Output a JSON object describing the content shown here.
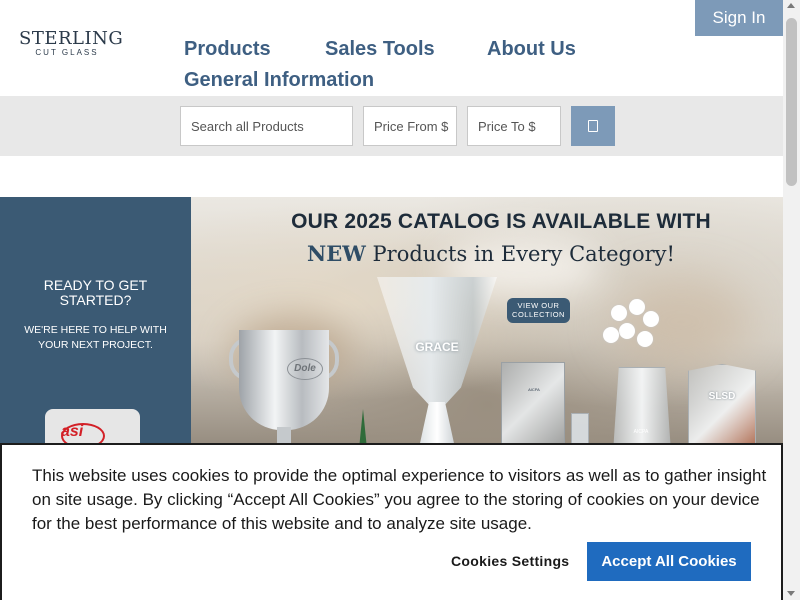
{
  "header": {
    "logo_main": "STERLING",
    "logo_sub": "CUT GLASS",
    "sign_in": "Sign In"
  },
  "nav": {
    "items": [
      "Products",
      "Sales Tools",
      "About Us",
      "General Information"
    ]
  },
  "search": {
    "search_placeholder": "Search all Products",
    "price_from_placeholder": "Price From $",
    "price_to_placeholder": "Price To $",
    "button_icon": "search-icon"
  },
  "hero": {
    "left": {
      "ready": "READY TO GET STARTED?",
      "help": "WE'RE HERE TO HELP WITH YOUR NEXT PROJECT.",
      "badge": "asi"
    },
    "headline_1": "OUR 2025 CATALOG IS AVAILABLE WITH",
    "headline_2_bold": "NEW",
    "headline_2_rest": " Products in Every Category!",
    "view_button": "VIEW OUR COLLECTION",
    "trophy_labels": {
      "cup": "Dole",
      "vase": "GRACE",
      "flower_vase": "AICPA",
      "slsd": "SLSD"
    }
  },
  "cookie_banner": {
    "text": "This website uses cookies to provide the optimal experience to visitors as well as to gather insight on site usage. By clicking “Accept All Cookies” you agree to the storing of cookies on your device for the best performance of this website and to analyze site usage.",
    "settings_label": "Cookies Settings",
    "accept_label": "Accept All Cookies"
  },
  "colors": {
    "nav_text": "#3e5f82",
    "accent_button": "#7d9ab8",
    "hero_panel": "#3b5a74",
    "cookie_accept": "#1f6bbf"
  }
}
